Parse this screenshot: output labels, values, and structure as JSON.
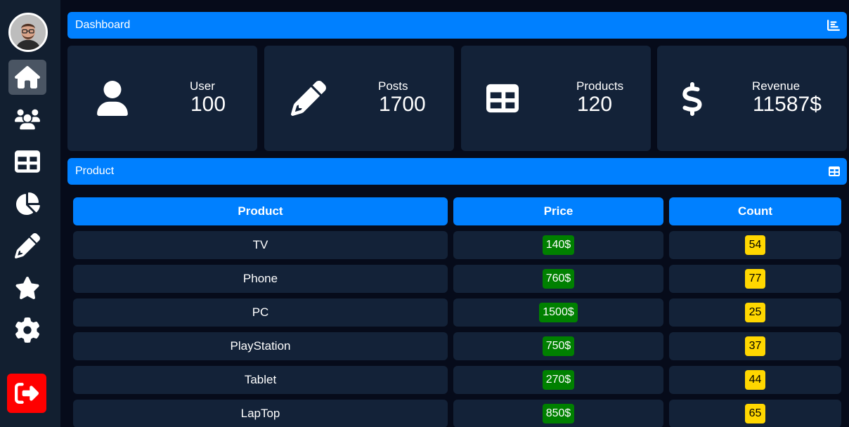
{
  "sidebar": {
    "items": [
      {
        "icon": "home-icon",
        "active": true
      },
      {
        "icon": "users-icon",
        "active": false
      },
      {
        "icon": "table-icon",
        "active": false
      },
      {
        "icon": "pie-chart-icon",
        "active": false
      },
      {
        "icon": "pencil-icon",
        "active": false
      },
      {
        "icon": "star-icon",
        "active": false
      },
      {
        "icon": "gear-icon",
        "active": false
      }
    ],
    "logout": {
      "icon": "sign-out-icon",
      "color": "#ff0000"
    }
  },
  "dashboard": {
    "title": "Dashboard",
    "icon": "chart-bar-icon"
  },
  "stats": [
    {
      "label": "User",
      "value": "100",
      "icon": "user-icon"
    },
    {
      "label": "Posts",
      "value": "1700",
      "icon": "pencil-icon"
    },
    {
      "label": "Products",
      "value": "120",
      "icon": "table-icon"
    },
    {
      "label": "Revenue",
      "value": "11587$",
      "icon": "dollar-icon"
    }
  ],
  "product_section": {
    "title": "Product",
    "icon": "table-icon"
  },
  "table": {
    "headers": [
      "Product",
      "Price",
      "Count"
    ],
    "rows": [
      {
        "product": "TV",
        "price": "140$",
        "count": "54"
      },
      {
        "product": "Phone",
        "price": "760$",
        "count": "77"
      },
      {
        "product": "PC",
        "price": "1500$",
        "count": "25"
      },
      {
        "product": "PlayStation",
        "price": "750$",
        "count": "37"
      },
      {
        "product": "Tablet",
        "price": "270$",
        "count": "44"
      },
      {
        "product": "LapTop",
        "price": "850$",
        "count": "65"
      }
    ]
  },
  "colors": {
    "accent": "#0080ff",
    "background": "#060b1a",
    "panel": "#132238",
    "price_badge": "#008000",
    "count_badge": "#ffd700"
  }
}
